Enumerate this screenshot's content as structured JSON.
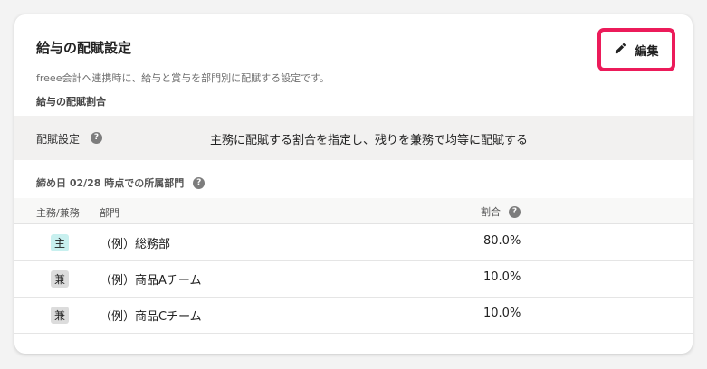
{
  "card": {
    "title": "給与の配賦設定",
    "description": "freee会計へ連携時に、給与と賞与を部門別に配賦する設定です。",
    "section_label": "給与の配賦割合",
    "edit_label": "編集"
  },
  "setting": {
    "label": "配賦設定",
    "value": "主務に配賦する割合を指定し、残りを兼務で均等に配賦する"
  },
  "departments": {
    "title": "締め日 02/28 時点での所属部門",
    "headers": {
      "role": "主務/兼務",
      "dept": "部門",
      "ratio": "割合"
    },
    "rows": [
      {
        "badge": "主",
        "name": "（例）総務部",
        "ratio": "80.0%"
      },
      {
        "badge": "兼",
        "name": "（例）商品Aチーム",
        "ratio": "10.0%"
      },
      {
        "badge": "兼",
        "name": "（例）商品Cチーム",
        "ratio": "10.0%"
      }
    ]
  },
  "colors": {
    "highlight": "#ec1b5a",
    "main_badge": "#c8f0ef",
    "sub_badge": "#dcdcdc"
  },
  "icons": {
    "edit": "pencil-icon",
    "help": "question-circle-icon"
  }
}
